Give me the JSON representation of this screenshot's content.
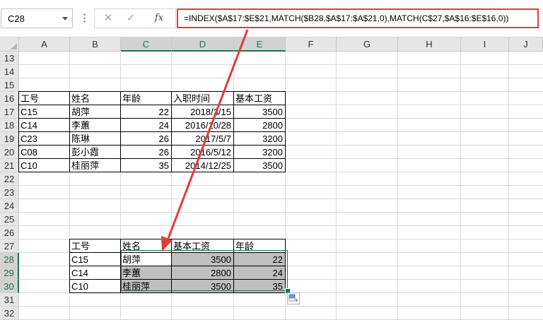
{
  "formula_bar": {
    "name_box": "C28",
    "formula": "=INDEX($A$17:$E$21,MATCH($B28,$A$17:$A$21,0),MATCH(C$27,$A$16:$E$16,0))",
    "fx_label": "fx",
    "cancel_icon": "✕",
    "enter_icon": "✓"
  },
  "columns": [
    "A",
    "B",
    "C",
    "D",
    "E",
    "F",
    "G",
    "H",
    "I",
    "J"
  ],
  "rows": [
    "13",
    "14",
    "15",
    "16",
    "17",
    "18",
    "19",
    "20",
    "21",
    "22",
    "23",
    "24",
    "25",
    "26",
    "27",
    "28",
    "29",
    "30",
    "31",
    "32"
  ],
  "source_table": {
    "headers": [
      "工号",
      "姓名",
      "年龄",
      "入职时间",
      "基本工资"
    ],
    "rows": [
      [
        "C15",
        "胡萍",
        "22",
        "2018/3/15",
        "3500"
      ],
      [
        "C14",
        "李蕙",
        "24",
        "2016/10/28",
        "2800"
      ],
      [
        "C23",
        "陈琳",
        "26",
        "2017/5/7",
        "3200"
      ],
      [
        "C08",
        "彭小霞",
        "26",
        "2016/5/12",
        "3200"
      ],
      [
        "C10",
        "桂丽萍",
        "35",
        "2014/12/25",
        "3500"
      ]
    ]
  },
  "result_table": {
    "headers": [
      "工号",
      "姓名",
      "基本工资",
      "年龄"
    ],
    "rows": [
      [
        "C15",
        "胡萍",
        "3500",
        "22"
      ],
      [
        "C14",
        "李蕙",
        "2800",
        "24"
      ],
      [
        "C10",
        "桂丽萍",
        "3500",
        "35"
      ]
    ]
  },
  "colors": {
    "accent_green": "#217346",
    "annotation_red": "#e23b3b",
    "shaded_fill": "#bfbfbf"
  }
}
